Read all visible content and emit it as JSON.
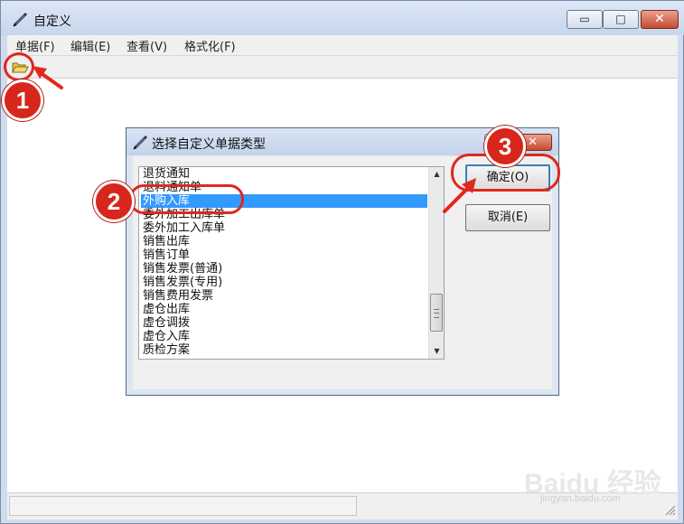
{
  "window": {
    "title": "自定义",
    "controls": {
      "minimize": "▭",
      "maximize": "□",
      "close": "✕"
    }
  },
  "menu": [
    "单据(F)",
    "编辑(E)",
    "查看(V)",
    "格式化(F)"
  ],
  "toolbar": {
    "open_icon": "open-folder-icon"
  },
  "dialog": {
    "title": "选择自定义单据类型",
    "help_glyph": "?",
    "close_glyph": "✕",
    "list_items": [
      "退货通知",
      "退料通知单",
      "外购入库",
      "委外加工出库单",
      "委外加工入库单",
      "销售出库",
      "销售订单",
      "销售发票(普通)",
      "销售发票(专用)",
      "销售费用发票",
      "虚仓出库",
      "虚仓调拨",
      "虚仓入库",
      "质检方案"
    ],
    "selected_item": "外购入库",
    "ok_label": "确定(O)",
    "cancel_label": "取消(E)"
  },
  "annotations": {
    "badge_1": "1",
    "badge_2": "2",
    "badge_3": "3",
    "color": "#d7261b"
  },
  "watermark": {
    "text": "Baidu 经验",
    "sub": "jingyan.baidu.com"
  }
}
